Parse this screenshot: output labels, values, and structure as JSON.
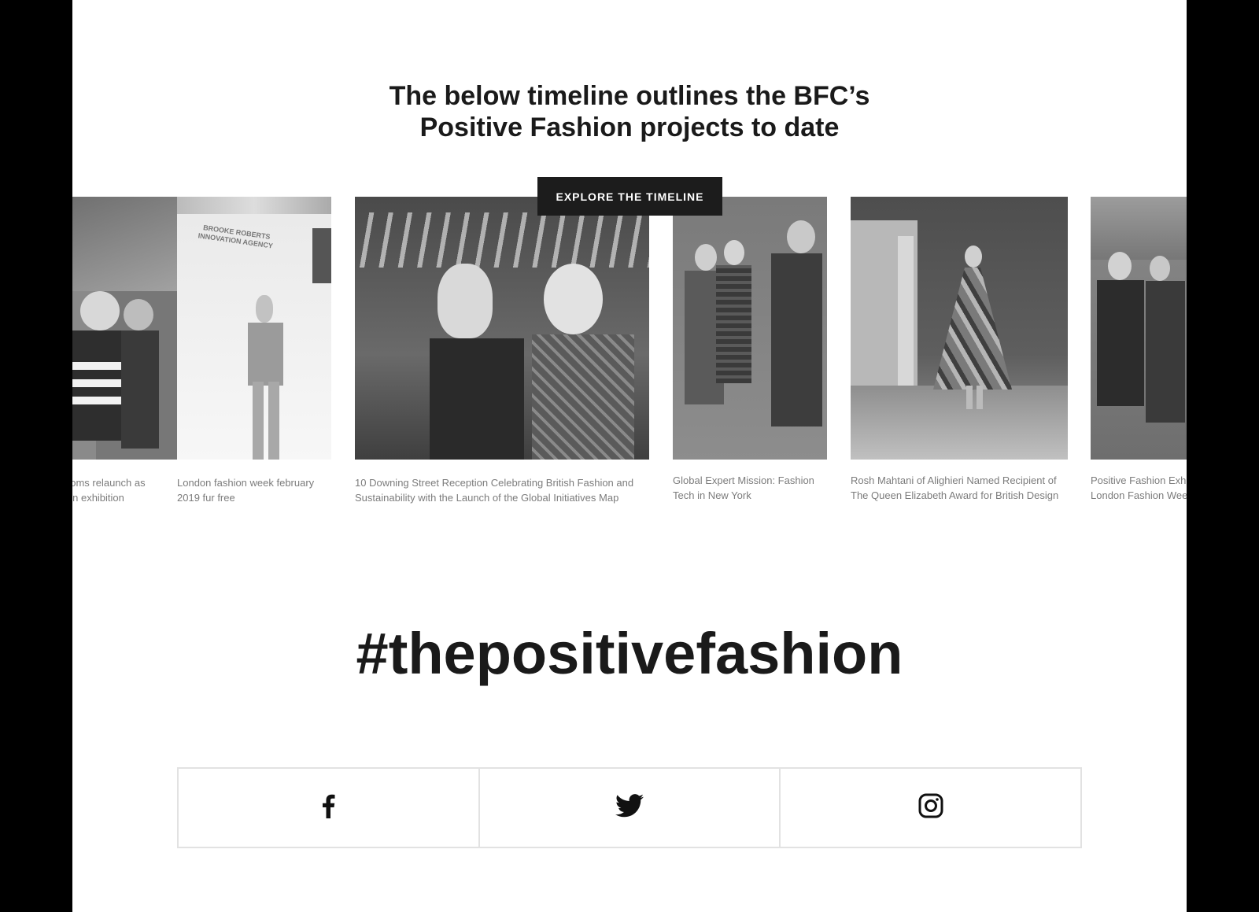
{
  "heading": {
    "line1": "The below timeline outlines the BFC’s",
    "line2": "Positive Fashion projects to date"
  },
  "explore_button": "EXPLORE THE TIMELINE",
  "timeline": [
    {
      "caption": "ooms relaunch as\nion exhibition"
    },
    {
      "caption": "London fashion week february 2019 fur free",
      "sign_text": "BROOKE ROBERTS\nINNOVATION AGENCY"
    },
    {
      "caption": "10 Downing Street Reception Celebrating British Fashion and Sustainability with the Launch of the Global Initiatives Map"
    },
    {
      "caption": "Global Expert Mission: Fashion Tech in New York"
    },
    {
      "caption": "Rosh Mahtani of Alighieri Named Recipient of The Queen Elizabeth Award for British Design"
    },
    {
      "caption": "Positive Fashion Exhi\nLondon Fashion Wee"
    }
  ],
  "hashtag": "#thepositivefashion",
  "social": [
    {
      "icon": "facebook-icon"
    },
    {
      "icon": "twitter-icon"
    },
    {
      "icon": "instagram-icon"
    }
  ]
}
